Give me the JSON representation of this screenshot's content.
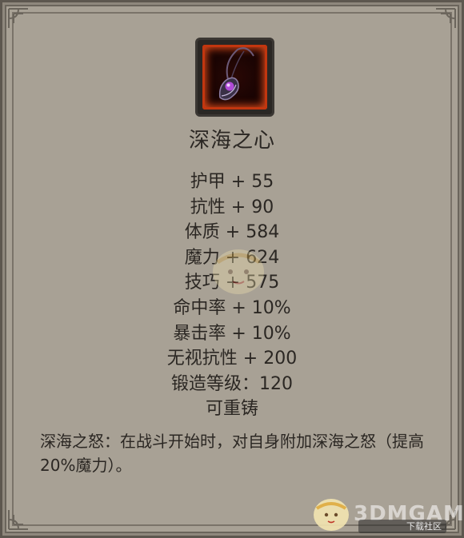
{
  "item": {
    "name": "深海之心",
    "icon": "amulet-icon",
    "stats": [
      "护甲 + 55",
      "抗性 + 90",
      "体质 + 584",
      "魔力 + 624",
      "技巧 + 575",
      "命中率 + 10%",
      "暴击率 + 10%",
      "无视抗性 + 200",
      "锻造等级：120",
      "可重铸"
    ],
    "description": "深海之怒：在战斗开始时，对自身附加深海之怒（提高20%魔力）。"
  },
  "watermark": {
    "text": "3DMGAME",
    "badge": "下载社区"
  },
  "colors": {
    "panel": "#a8a195",
    "text": "#2b2723",
    "icon_border": "#c2360f",
    "gem": "#b14bd8"
  }
}
